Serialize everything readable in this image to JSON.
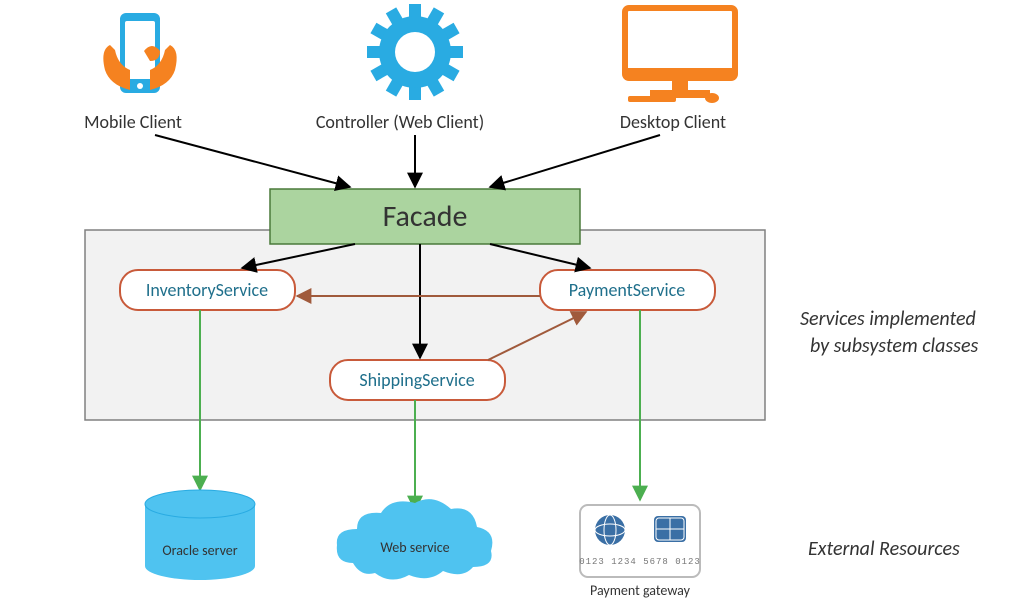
{
  "clients": {
    "mobile": {
      "label": "Mobile Client"
    },
    "web": {
      "label": "Controller (Web Client)"
    },
    "desktop": {
      "label": "Desktop Client"
    }
  },
  "facade": {
    "label": "Facade"
  },
  "services": {
    "inventory": {
      "label": "InventoryService"
    },
    "payment": {
      "label": "PaymentService"
    },
    "shipping": {
      "label": "ShippingService"
    }
  },
  "resources": {
    "oracle": {
      "label": "Oracle server"
    },
    "web": {
      "label": "Web service"
    },
    "gateway": {
      "label": "Payment gateway",
      "digits": "0123 1234 5678 0123"
    }
  },
  "sideLabels": {
    "services_l1": "Services implemented",
    "services_l2": "by subsystem classes",
    "resources": "External Resources"
  },
  "colors": {
    "blue": "#29abe2",
    "orange": "#f58220",
    "green": "#abd49f",
    "greenBorder": "#4a7a3a",
    "grey": "#f2f2f2",
    "greyBorder": "#808080",
    "svcBorder": "#c85a3a",
    "arrowBlack": "#000000",
    "arrowBrown": "#a05a3c",
    "arrowGreen": "#4caf50"
  }
}
